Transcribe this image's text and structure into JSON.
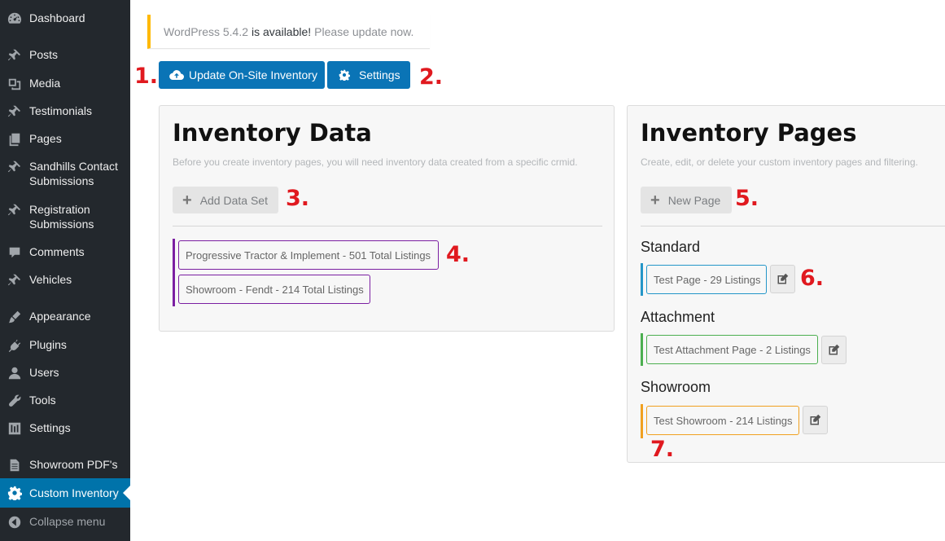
{
  "sidebar": {
    "items": [
      {
        "label": "Dashboard",
        "icon": "dashboard-icon"
      },
      {
        "label": "Posts",
        "icon": "pin-icon"
      },
      {
        "label": "Media",
        "icon": "media-icon"
      },
      {
        "label": "Testimonials",
        "icon": "pin-icon"
      },
      {
        "label": "Pages",
        "icon": "pages-icon"
      },
      {
        "label": "Sandhills Contact Submissions",
        "icon": "pin-icon"
      },
      {
        "label": "Registration Submissions",
        "icon": "pin-icon"
      },
      {
        "label": "Comments",
        "icon": "comment-icon"
      },
      {
        "label": "Vehicles",
        "icon": "pin-icon"
      },
      {
        "label": "Appearance",
        "icon": "brush-icon"
      },
      {
        "label": "Plugins",
        "icon": "plug-icon"
      },
      {
        "label": "Users",
        "icon": "user-icon"
      },
      {
        "label": "Tools",
        "icon": "wrench-icon"
      },
      {
        "label": "Settings",
        "icon": "sliders-icon"
      },
      {
        "label": "Showroom PDF's",
        "icon": "document-icon"
      },
      {
        "label": "Custom Inventory",
        "icon": "gear-icon"
      },
      {
        "label": "Collapse menu",
        "icon": "collapse-icon"
      }
    ]
  },
  "notice": {
    "version_text": "WordPress 5.4.2",
    "middle_text": "is available!",
    "link_text": "Please update now."
  },
  "toolbar": {
    "update_label": "Update On-Site Inventory",
    "settings_label": "Settings"
  },
  "steps": [
    "1.",
    "2.",
    "3.",
    "4.",
    "5.",
    "6.",
    "7."
  ],
  "inventory_data": {
    "title": "Inventory Data",
    "description": "Before you create inventory pages, you will need inventory data created from a specific crmid.",
    "add_label": "Add Data Set",
    "datasets": [
      "Progressive Tractor & Implement - 501 Total Listings",
      "Showroom - Fendt - 214 Total Listings"
    ]
  },
  "inventory_pages": {
    "title": "Inventory Pages",
    "description": "Create, edit, or delete your custom inventory pages and filtering.",
    "new_label": "New Page",
    "categories": [
      {
        "heading": "Standard",
        "page": "Test Page - 29 Listings",
        "color": "#2496c8"
      },
      {
        "heading": "Attachment",
        "page": "Test Attachment Page - 2 Listings",
        "color": "#4caf50"
      },
      {
        "heading": "Showroom",
        "page": "Test Showroom - 214 Listings",
        "color": "#f0a020"
      }
    ]
  },
  "colors": {
    "sidebar_bg": "#23282d",
    "accent": "#0073aa",
    "step_red": "#e0191f",
    "notice_border": "#ffb900",
    "dataset_purple": "#7b1fa2"
  }
}
